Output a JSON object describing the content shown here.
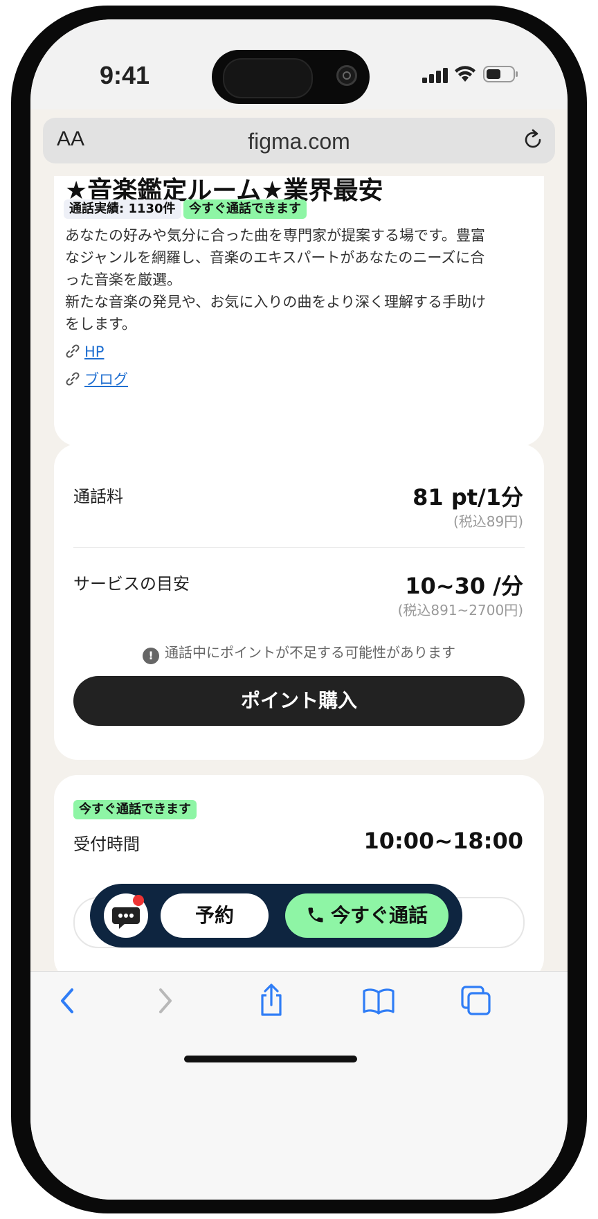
{
  "status_bar": {
    "time": "9:41"
  },
  "browser": {
    "url": "figma.com",
    "text_size_label": "AA"
  },
  "profile": {
    "title": "★音楽鑑定ルーム★業界最安",
    "call_record": "通話実績: 1130件",
    "available_badge": "今すぐ通話できます",
    "description": "あなたの好みや気分に合った曲を専門家が提案する場です。豊富なジャンルを網羅し、音楽のエキスパートがあなたのニーズに合った音楽を厳選。\n新たな音楽の発見や、お気に入りの曲をより深く理解する手助けをします。",
    "links": [
      {
        "label": "HP"
      },
      {
        "label": "ブログ"
      }
    ]
  },
  "pricing": {
    "call_fee_label": "通話料",
    "call_fee_value": "81 pt/1分",
    "call_fee_tax": "(税込89円)",
    "service_label": "サービスの目安",
    "service_value": "10~30 /分",
    "service_tax": "(税込891~2700円)",
    "warning": "通話中にポイントが不足する可能性があります",
    "buy_button": "ポイント購入"
  },
  "hours": {
    "badge": "今すぐ通話できます",
    "label": "受付時間",
    "value": "10:00~18:00"
  },
  "action_bar": {
    "reserve_label": "予約",
    "call_label": "今すぐ通話"
  },
  "colors": {
    "accent_green": "#8ef5a5",
    "action_bar_bg": "#0e2540",
    "link_blue": "#1f6fd1",
    "ios_blue": "#2f7df6"
  }
}
